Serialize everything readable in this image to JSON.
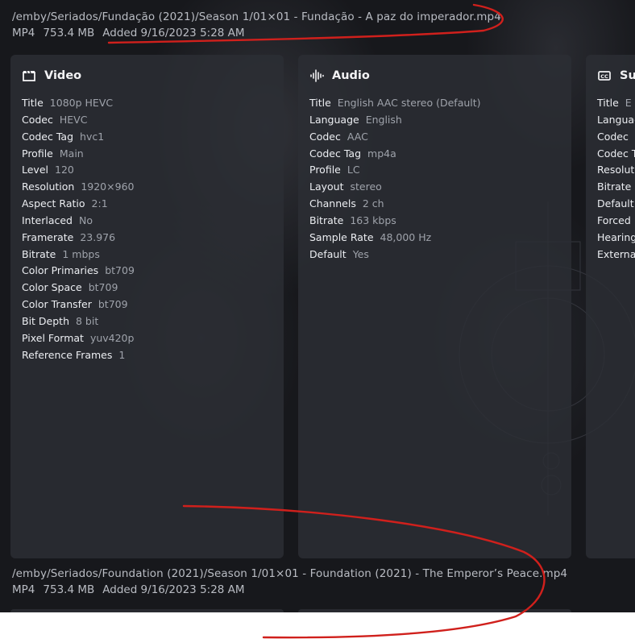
{
  "file1": {
    "path": "/emby/Seriados/Fundação (2021)/Season 1/01×01 - Fundação - A paz do imperador.mp4",
    "container": "MP4",
    "size": "753.4 MB",
    "added": "Added 9/16/2023 5:28 AM"
  },
  "file2": {
    "path": "/emby/Seriados/Foundation (2021)/Season 1/01×01 - Foundation (2021) - The Emperor’s Peace.mp4",
    "container": "MP4",
    "size": "753.4 MB",
    "added": "Added 9/16/2023 5:28 AM"
  },
  "video": {
    "heading": "Video",
    "icon": "clapperboard-icon",
    "rows": [
      {
        "k": "Title",
        "v": "1080p HEVC"
      },
      {
        "k": "Codec",
        "v": "HEVC"
      },
      {
        "k": "Codec Tag",
        "v": "hvc1"
      },
      {
        "k": "Profile",
        "v": "Main"
      },
      {
        "k": "Level",
        "v": "120"
      },
      {
        "k": "Resolution",
        "v": "1920×960"
      },
      {
        "k": "Aspect Ratio",
        "v": "2:1"
      },
      {
        "k": "Interlaced",
        "v": "No"
      },
      {
        "k": "Framerate",
        "v": "23.976"
      },
      {
        "k": "Bitrate",
        "v": "1 mbps"
      },
      {
        "k": "Color Primaries",
        "v": "bt709"
      },
      {
        "k": "Color Space",
        "v": "bt709"
      },
      {
        "k": "Color Transfer",
        "v": "bt709"
      },
      {
        "k": "Bit Depth",
        "v": "8 bit"
      },
      {
        "k": "Pixel Format",
        "v": "yuv420p"
      },
      {
        "k": "Reference Frames",
        "v": "1"
      }
    ]
  },
  "audio": {
    "heading": "Audio",
    "icon": "audio-waveform-icon",
    "rows": [
      {
        "k": "Title",
        "v": "English AAC stereo (Default)"
      },
      {
        "k": "Language",
        "v": "English"
      },
      {
        "k": "Codec",
        "v": "AAC"
      },
      {
        "k": "Codec Tag",
        "v": "mp4a"
      },
      {
        "k": "Profile",
        "v": "LC"
      },
      {
        "k": "Layout",
        "v": "stereo"
      },
      {
        "k": "Channels",
        "v": "2 ch"
      },
      {
        "k": "Bitrate",
        "v": "163 kbps"
      },
      {
        "k": "Sample Rate",
        "v": "48,000 Hz"
      },
      {
        "k": "Default",
        "v": "Yes"
      }
    ]
  },
  "subtitle": {
    "heading": "Su",
    "icon": "closed-caption-icon",
    "rows": [
      {
        "k": "Title",
        "v": "E"
      },
      {
        "k": "Languag",
        "v": ""
      },
      {
        "k": "Codec",
        "v": ""
      },
      {
        "k": "Codec T",
        "v": ""
      },
      {
        "k": "Resoluti",
        "v": ""
      },
      {
        "k": "Bitrate",
        "v": ""
      },
      {
        "k": "Default",
        "v": ""
      },
      {
        "k": "Forced",
        "v": ""
      },
      {
        "k": "Hearing",
        "v": ""
      },
      {
        "k": "Externa",
        "v": ""
      }
    ]
  },
  "colors": {
    "annotation": "#d0201c",
    "card_bg": "#2c2e34",
    "page_bg": "#17181c"
  }
}
